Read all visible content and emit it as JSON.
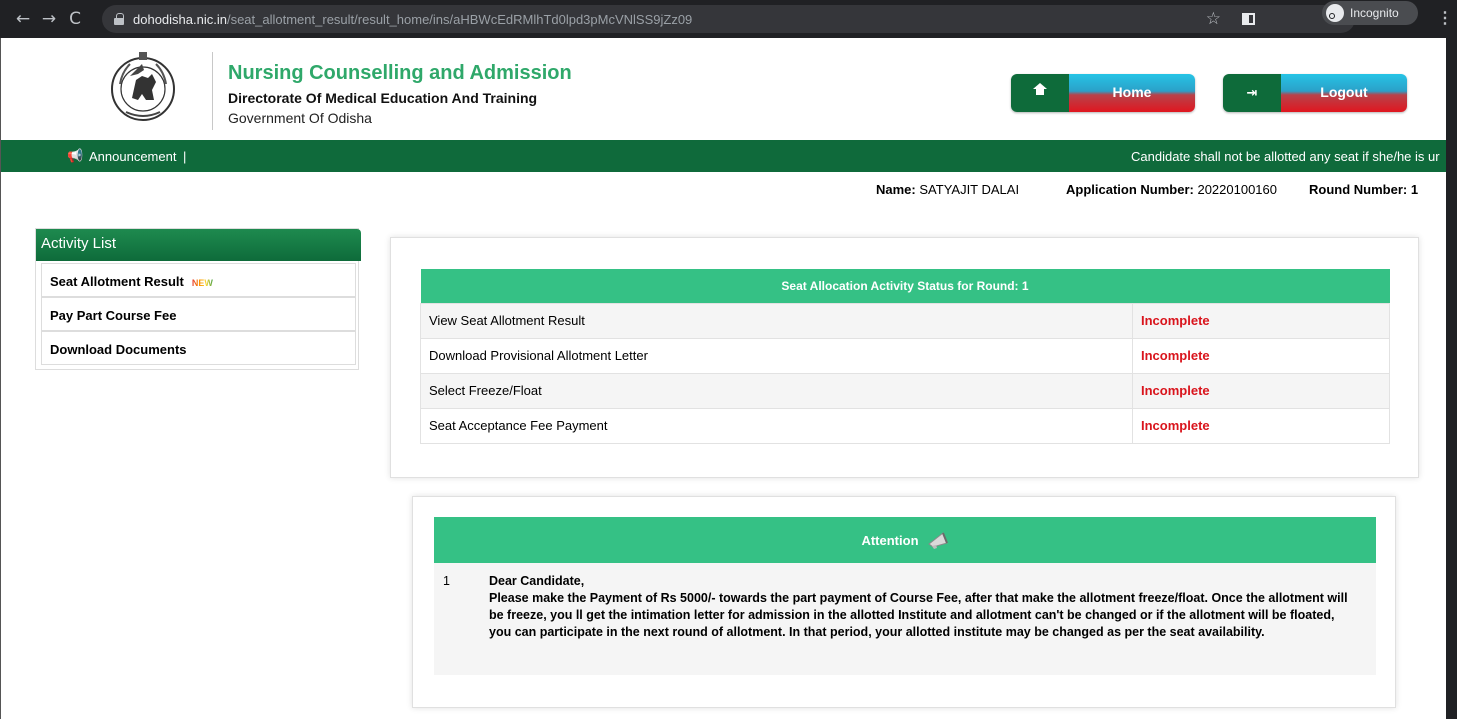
{
  "browser": {
    "url_host": "dohodisha.nic.in",
    "url_path": "/seat_allotment_result/result_home/ins/aHBWcEdRMlhTd0lpd3pMcVNlSS9jZz09",
    "incognito_label": "Incognito"
  },
  "header": {
    "title": "Nursing Counselling and Admission",
    "subtitle": "Directorate Of Medical Education And Training",
    "subtitle2": "Government Of Odisha",
    "home_label": "Home",
    "logout_label": "Logout"
  },
  "announcement": {
    "label": "Announcement",
    "separator": "|",
    "marquee": "Candidate shall not be allotted any seat if she/he is ur"
  },
  "candidate": {
    "name_label": "Name:",
    "name_value": "SATYAJIT DALAI",
    "app_label": "Application Number:",
    "app_value": "20220100160",
    "round_label": "Round Number:",
    "round_value": "1"
  },
  "sidebar": {
    "heading": "Activity List",
    "items": [
      {
        "label": "Seat Allotment Result",
        "badge": "NEW"
      },
      {
        "label": "Pay Part Course Fee"
      },
      {
        "label": "Download Documents"
      }
    ]
  },
  "status_table": {
    "heading": "Seat Allocation Activity Status for Round:  1",
    "rows": [
      {
        "activity": "View Seat Allotment Result",
        "status": "Incomplete"
      },
      {
        "activity": "Download Provisional Allotment Letter",
        "status": "Incomplete"
      },
      {
        "activity": "Select Freeze/Float",
        "status": "Incomplete"
      },
      {
        "activity": "Seat Acceptance Fee Payment",
        "status": "Incomplete"
      }
    ]
  },
  "attention": {
    "heading": "Attention",
    "number": "1",
    "greeting": "Dear Candidate,",
    "message": "Please make the Payment of Rs 5000/- towards the part payment of Course Fee, after that make the allotment freeze/float. Once the allotment will be freeze, you ll get the intimation letter for admission in the allotted Institute and allotment can't be changed or if the allotment will be floated, you can participate in the next round of allotment. In that period, your allotted institute may be changed as per the seat availability."
  },
  "colors": {
    "brand_green": "#2fa86a",
    "dark_green": "#0f6a3b",
    "table_green": "#35c185",
    "status_red": "#d9141c"
  }
}
